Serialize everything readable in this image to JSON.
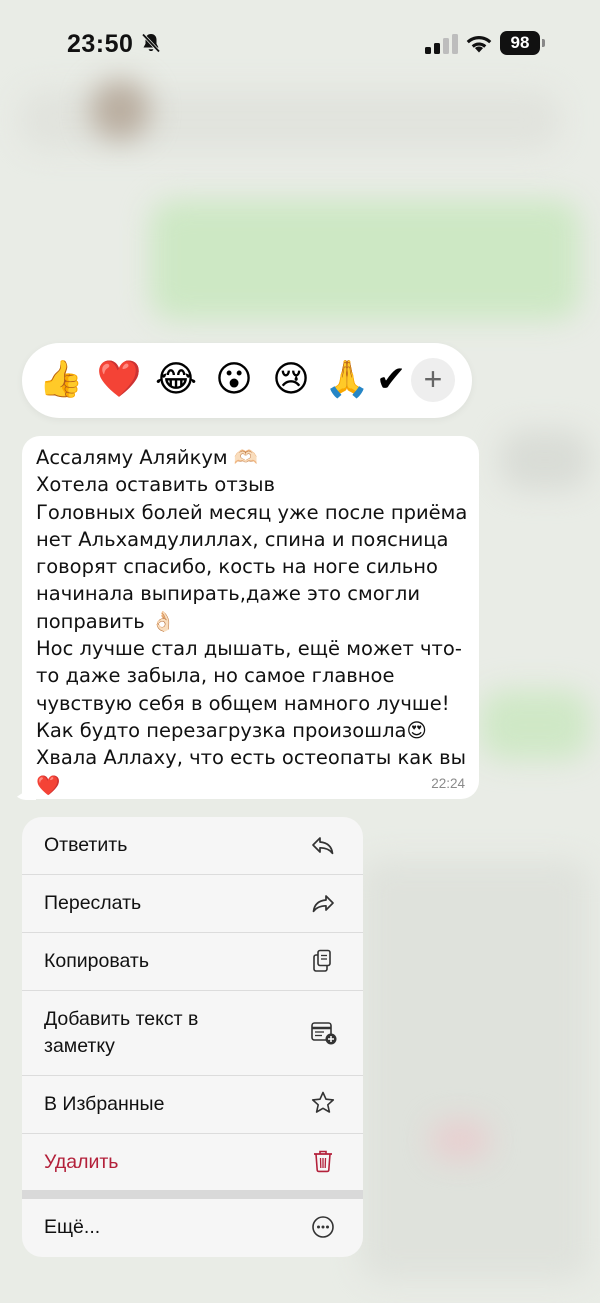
{
  "status_bar": {
    "time": "23:50",
    "battery": "98",
    "icons": [
      "bell-slash-icon",
      "cellular-signal-icon",
      "wifi-icon",
      "battery-icon"
    ]
  },
  "reactions": {
    "items": [
      "👍",
      "❤️",
      "😂",
      "😮",
      "😢",
      "🙏",
      "✔"
    ],
    "add_label": "+"
  },
  "message": {
    "text": "Ассаляму Аляйкум 🫶🏻\nХотела оставить отзыв\nГоловных болей месяц уже после приёма нет Альхамдулиллах, спина и поясница говорят спасибо, кость на ноге сильно начинала выпирать,даже это смогли поправить 👌🏻\nНос лучше стал дышать, ещё может что-то даже забыла, но самое главное чувствую себя в общем намного лучше! Как будто перезагрузка произошла😍\nХвала Аллаху, что есть остеопаты как вы❤️",
    "time": "22:24"
  },
  "menu": {
    "reply": "Ответить",
    "forward": "Переслать",
    "copy": "Копировать",
    "add_note": "Добавить текст в\nзаметку",
    "favorites": "В Избранные",
    "delete": "Удалить",
    "more": "Ещё..."
  },
  "colors": {
    "danger": "#b3203a",
    "bubble": "#ffffff",
    "menu_bg": "#f6f6f6"
  }
}
